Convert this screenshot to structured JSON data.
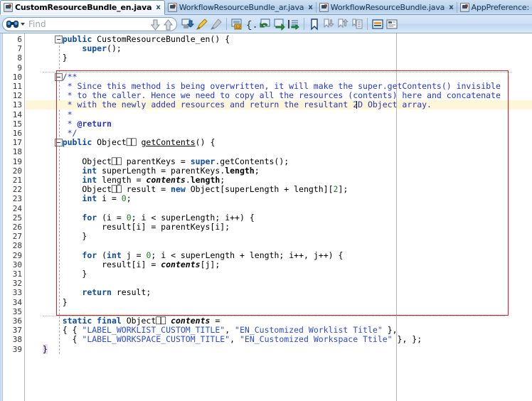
{
  "window": {
    "tabs": [
      {
        "label": "CustomResourceBundle_en.java",
        "icon": "java-file-icon",
        "active": true,
        "close": "x"
      },
      {
        "label": "WorkflowResourceBundle_ar.java",
        "icon": "java-file-icon",
        "active": false,
        "close": "x"
      },
      {
        "label": "WorkflowResourceBundle.java",
        "icon": "java-file-icon",
        "active": false,
        "close": "x"
      },
      {
        "label": "AppPreference:",
        "icon": "java-file-icon",
        "active": false,
        "close": ""
      }
    ]
  },
  "toolbar": {
    "find_placeholder": "Find",
    "find_value": "",
    "search_icon": "binoculars-icon",
    "dropdown_icon": "chevron-down-icon",
    "find_prev_icon": "arrow-down-icon",
    "find_next_icon": "arrow-up-icon",
    "buttons": [
      {
        "name": "refactor-icon",
        "title": ""
      },
      {
        "name": "highlight-pen-icon",
        "title": ""
      },
      {
        "name": "eraser-icon",
        "title": ""
      },
      {
        "name": "goto-line-icon",
        "title": ""
      },
      {
        "name": "braces-icon",
        "title": ""
      },
      {
        "name": "back-navigate-icon",
        "title": ""
      },
      {
        "name": "forward-navigate-icon",
        "title": ""
      },
      {
        "name": "indent-block-icon",
        "title": ""
      },
      {
        "name": "bookmark-icon",
        "title": ""
      },
      {
        "name": "bookmark-next-icon",
        "title": ""
      },
      {
        "name": "bookmark-prev-icon",
        "title": ""
      },
      {
        "name": "copy-lines-icon",
        "title": ""
      },
      {
        "name": "toggle-panel-icon",
        "title": ""
      },
      {
        "name": "toggle-header-icon",
        "title": ""
      }
    ]
  },
  "editor": {
    "first_line": 6,
    "last_line": 39,
    "highlighted_line": 13,
    "caret_line": 13,
    "margin_column_x": 617,
    "annotation_box": {
      "color": "#e01b1b",
      "from_line": 10,
      "to_line": 35
    },
    "fold_markers": [
      6,
      10,
      17
    ],
    "block_band": {
      "from_line": 10,
      "to_line": 17,
      "color": "#dbe6f4"
    },
    "lines": [
      {
        "n": 6,
        "html": "    <span class=\"kw\">public</span> CustomResourceBundle_en() {"
      },
      {
        "n": 7,
        "html": "        <span class=\"kw\">super</span>();"
      },
      {
        "n": 8,
        "html": "    }"
      },
      {
        "n": 9,
        "html": ""
      },
      {
        "n": 10,
        "html": "    <span class=\"cmt\">/**</span>"
      },
      {
        "n": 11,
        "html": "     <span class=\"cmt\">* Since this method is being overwritten, it will make the super.getContents() invisible</span>"
      },
      {
        "n": 12,
        "html": "     <span class=\"cmt\">* to the caller. Hence we need to copy all the resources (contents) here and concatenate</span>"
      },
      {
        "n": 13,
        "html": "     <span class=\"cmt\">* with the newly added resources and return the resultant 2D Object array.</span>"
      },
      {
        "n": 14,
        "html": "     <span class=\"cmt\">*</span>"
      },
      {
        "n": 15,
        "html": "     <span class=\"cmt\">* <b>@return</b></span>"
      },
      {
        "n": 16,
        "html": "     <span class=\"cmt\">*/</span>"
      },
      {
        "n": 17,
        "html": "    <span class=\"kw\">public</span> Object⎕⎕ <span class=\"udl\">getContents</span>() {"
      },
      {
        "n": 18,
        "html": ""
      },
      {
        "n": 19,
        "html": "        Object⎕⎕ parentKeys = <span class=\"kw\">super</span>.getContents();"
      },
      {
        "n": 20,
        "html": "        <span class=\"kw\">int</span> superLength = parentKeys.<span class=\"bld\">length</span>;"
      },
      {
        "n": 21,
        "html": "        <span class=\"kw\">int</span> length = <span class=\"fld\">contents</span>.<span class=\"bld\">length</span>;"
      },
      {
        "n": 22,
        "html": "        Object⎕⎕ result = <span class=\"kw\">new</span> Object[superLength + length][<span class=\"num\">2</span>];"
      },
      {
        "n": 23,
        "html": "        <span class=\"kw\">int</span> i = <span class=\"num\">0</span>;"
      },
      {
        "n": 24,
        "html": ""
      },
      {
        "n": 25,
        "html": "        <span class=\"kw\">for</span> (i = <span class=\"num\">0</span>; i &lt; superLength; i++) {"
      },
      {
        "n": 26,
        "html": "            result[i] = parentKeys[i];"
      },
      {
        "n": 27,
        "html": "        }"
      },
      {
        "n": 28,
        "html": ""
      },
      {
        "n": 29,
        "html": "        <span class=\"kw\">for</span> (<span class=\"kw\">int</span> j = <span class=\"num\">0</span>; i &lt; superLength + length; i++, j++) {"
      },
      {
        "n": 30,
        "html": "            result[i] = <span class=\"fld\">contents</span>[j];"
      },
      {
        "n": 31,
        "html": "        }"
      },
      {
        "n": 32,
        "html": ""
      },
      {
        "n": 33,
        "html": "        <span class=\"kw\">return</span> result;"
      },
      {
        "n": 34,
        "html": "    }"
      },
      {
        "n": 35,
        "html": ""
      },
      {
        "n": 36,
        "html": "    <span class=\"kw\">static final</span> Object⎕⎕ <span class=\"fld\">contents</span> ="
      },
      {
        "n": 37,
        "html": "    { { <span class=\"str\">\"LABEL_WORKLIST_CUSTOM_TITLE\"</span>, <span class=\"str\">\"EN_Customized Worklist Title\"</span> },"
      },
      {
        "n": 38,
        "html": "      { <span class=\"str\">\"LABEL_WORKSPACE_CUSTOM_TITLE\"</span>, <span class=\"str\">\"EN_Customized Workspace Ttile\"</span> }, };"
      },
      {
        "n": 39,
        "html": "<span class=\"bmatch\">}</span>"
      }
    ],
    "plain_text_lines": [
      "    public CustomResourceBundle_en() {",
      "        super();",
      "    }",
      "",
      "    /**",
      "     * Since this method is being overwritten, it will make the super.getContents() invisible",
      "     * to the caller. Hence we need to copy all the resources (contents) here and concatenate",
      "     * with the newly added resources and return the resultant 2D Object array.",
      "     *",
      "     * @return",
      "     */",
      "    public Object[][] getContents() {",
      "",
      "        Object[][] parentKeys = super.getContents();",
      "        int superLength = parentKeys.length;",
      "        int length = contents.length;",
      "        Object[][] result = new Object[superLength + length][2];",
      "        int i = 0;",
      "",
      "        for (i = 0; i < superLength; i++) {",
      "            result[i] = parentKeys[i];",
      "        }",
      "",
      "        for (int j = 0; i < superLength + length; i++, j++) {",
      "            result[i] = contents[j];",
      "        }",
      "",
      "        return result;",
      "    }",
      "",
      "    static final Object[][] contents =",
      "    { { \"LABEL_WORKLIST_CUSTOM_TITLE\", \"EN_Customized Worklist Title\" },",
      "      { \"LABEL_WORKSPACE_CUSTOM_TITLE\", \"EN_Customized Workspace Ttile\" }, };",
      "}"
    ]
  },
  "colors": {
    "keyword": "#0c4ba4",
    "comment": "#2436cf",
    "string": "#2a4bd7",
    "number": "#1a7a1a",
    "annotation_box": "#e01b1b",
    "highlight_line": "#fdf6d8",
    "block_band": "#dbe6f4"
  }
}
